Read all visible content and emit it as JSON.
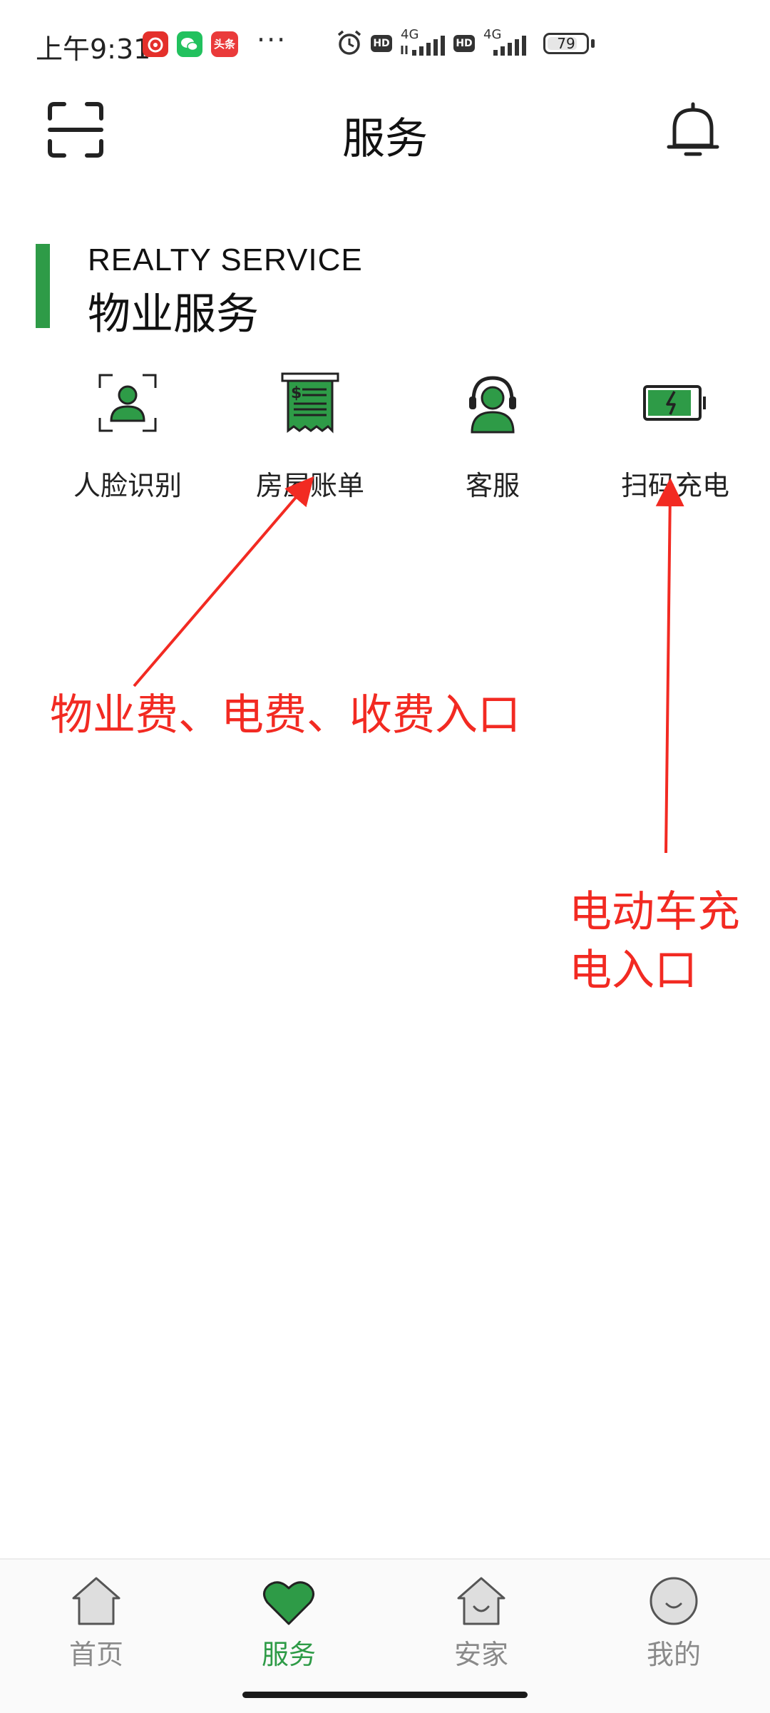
{
  "status_bar": {
    "time": "上午9:31",
    "toutiao_label": "头条",
    "more": "···",
    "network_1": "4G",
    "network_2": "4G",
    "hd_1": "HD",
    "hd_2": "HD",
    "battery": "79",
    "battery_level": 0.79
  },
  "header": {
    "title": "服务"
  },
  "section": {
    "title_en": "REALTY SERVICE",
    "title_cn": "物业服务",
    "accent": "#2e9b47"
  },
  "services": [
    {
      "label": "人脸识别",
      "icon": "face-recognition-icon"
    },
    {
      "label": "房屋账单",
      "icon": "house-bill-icon"
    },
    {
      "label": "客服",
      "icon": "customer-service-icon"
    },
    {
      "label": "扫码充电",
      "icon": "scan-charge-icon"
    }
  ],
  "annotations": {
    "fees": "物业费、电费、收费入口",
    "charging_line1": "电动车充",
    "charging_line2": "电入口",
    "color": "#f22a22"
  },
  "bottom_nav": [
    {
      "label": "首页",
      "icon": "home-icon",
      "active": false
    },
    {
      "label": "服务",
      "icon": "heart-icon",
      "active": true
    },
    {
      "label": "安家",
      "icon": "house-smile-icon",
      "active": false
    },
    {
      "label": "我的",
      "icon": "profile-icon",
      "active": false
    }
  ]
}
